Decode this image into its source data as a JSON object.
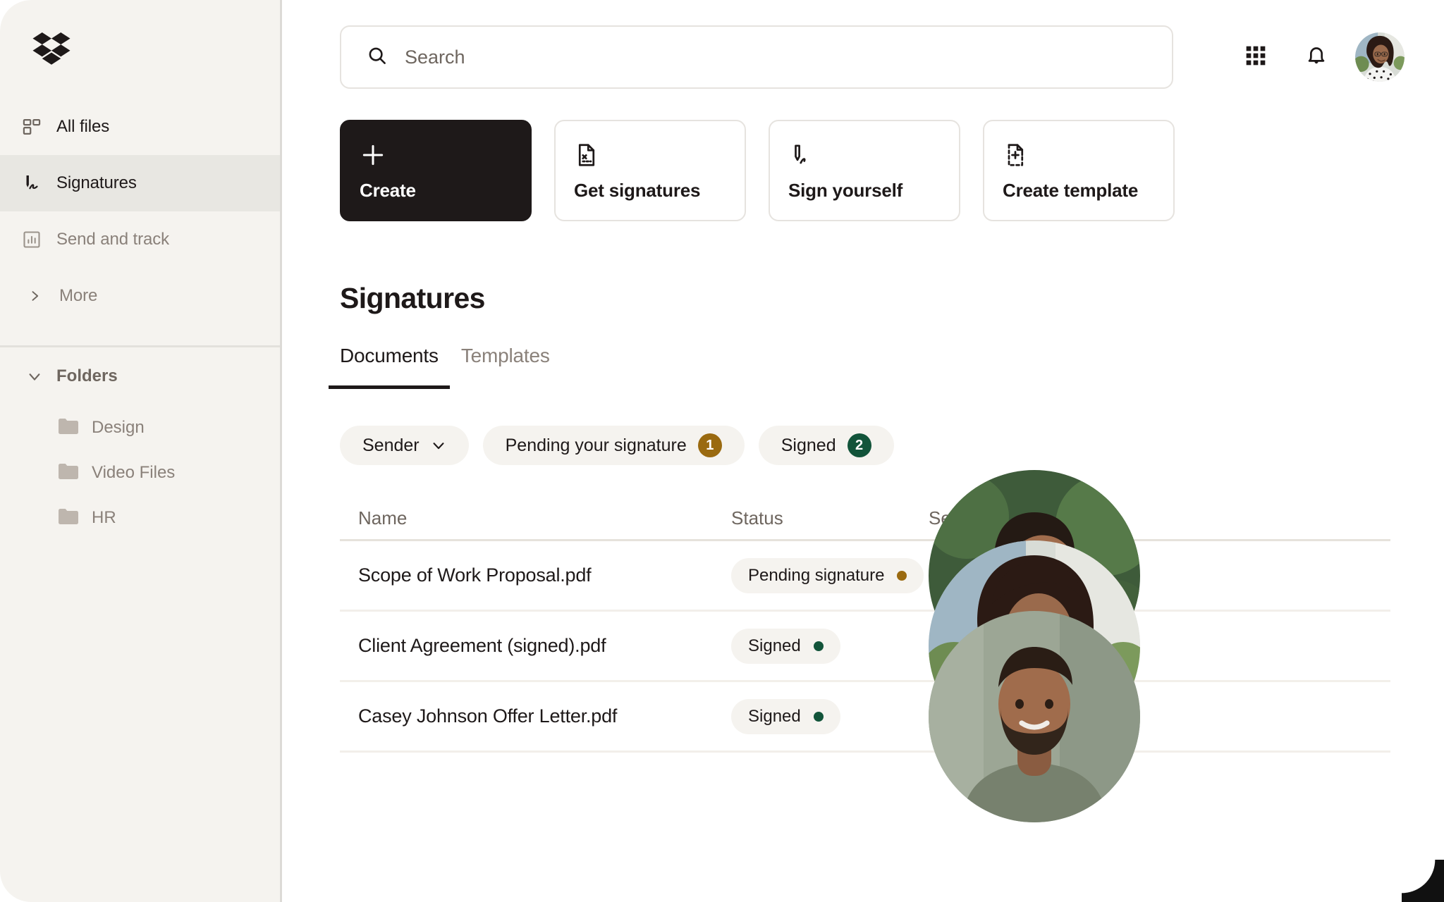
{
  "brand": {
    "logo_icon": "dropbox-logo",
    "accent_dark": "#1E1919",
    "sidebar_bg": "#F5F3EF",
    "pending_color": "#9A6A10",
    "signed_color": "#12543A"
  },
  "sidebar": {
    "nav": [
      {
        "label": "All files",
        "icon": "all-files-icon",
        "active": false
      },
      {
        "label": "Signatures",
        "icon": "signature-icon",
        "active": true
      },
      {
        "label": "Send and track",
        "icon": "send-and-track-icon",
        "active": false
      },
      {
        "label": "More",
        "icon": "chevron-right-icon",
        "active": false
      }
    ],
    "folders_section": {
      "title": "Folders",
      "icon": "chevron-down-icon",
      "items": [
        {
          "label": "Design",
          "icon": "folder-icon"
        },
        {
          "label": "Video Files",
          "icon": "folder-icon"
        },
        {
          "label": "HR",
          "icon": "folder-icon"
        }
      ]
    }
  },
  "topbar": {
    "search": {
      "value": "",
      "placeholder": "Search",
      "icon": "search-icon"
    },
    "apps_grid_icon": "apps-grid-icon",
    "notifications_icon": "bell-icon",
    "avatar": "user-avatar"
  },
  "actions": [
    {
      "label": "Create",
      "icon": "plus-icon",
      "primary": true
    },
    {
      "label": "Get signatures",
      "icon": "document-signature-request-icon",
      "primary": false
    },
    {
      "label": "Sign yourself",
      "icon": "pen-signature-icon",
      "primary": false
    },
    {
      "label": "Create template",
      "icon": "document-add-template-icon",
      "primary": false
    }
  ],
  "page": {
    "title": "Signatures",
    "tabs": [
      {
        "label": "Documents",
        "active": true
      },
      {
        "label": "Templates",
        "active": false
      }
    ],
    "filters": [
      {
        "label": "Sender",
        "type": "dropdown",
        "icon": "chevron-down-icon"
      },
      {
        "label": "Pending your signature",
        "type": "count",
        "count": "1",
        "badge_color": "#9A6A10"
      },
      {
        "label": "Signed",
        "type": "count",
        "count": "2",
        "badge_color": "#12543A"
      }
    ],
    "table": {
      "columns": [
        "Name",
        "Status",
        "Sender"
      ],
      "rows": [
        {
          "name": "Scope of Work Proposal.pdf",
          "status": "Pending signature",
          "status_color": "#9A6A10",
          "sender_avatar": "sender-avatar-1"
        },
        {
          "name": "Client Agreement (signed).pdf",
          "status": "Signed",
          "status_color": "#12543A",
          "sender_avatar": "sender-avatar-2"
        },
        {
          "name": "Casey Johnson Offer Letter.pdf",
          "status": "Signed",
          "status_color": "#12543A",
          "sender_avatar": "sender-avatar-3"
        }
      ]
    }
  }
}
